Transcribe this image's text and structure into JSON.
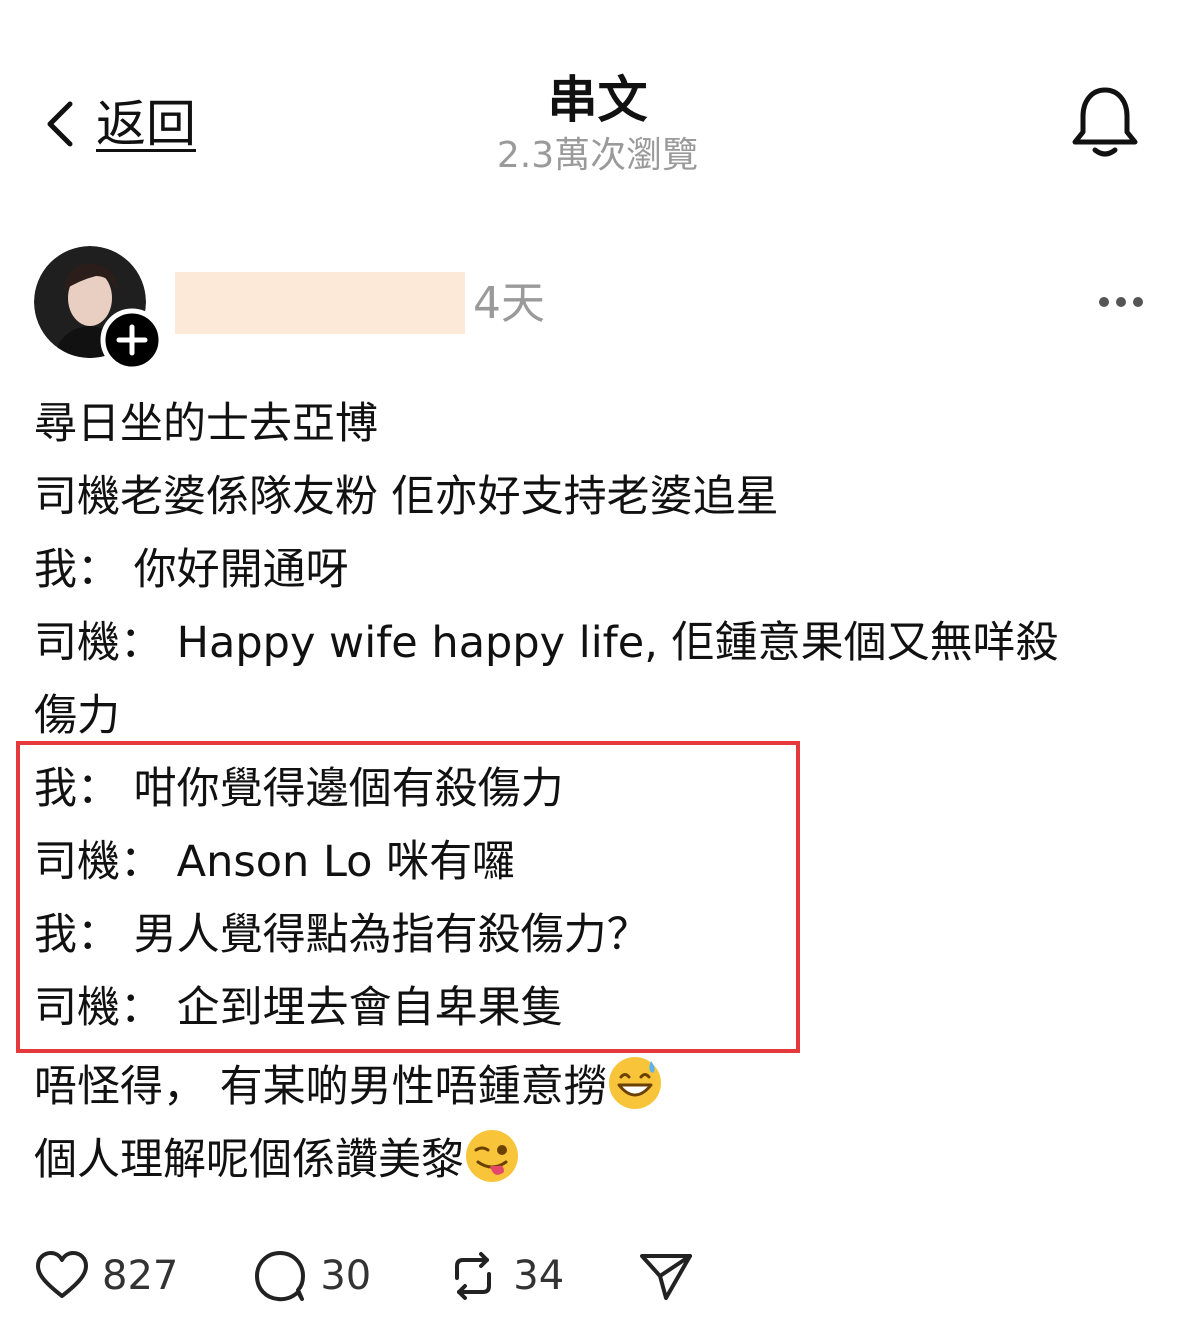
{
  "header": {
    "back_label": "返回",
    "title": "串文",
    "views": "2.3萬次瀏覽"
  },
  "post": {
    "time": "4天",
    "lines_before": [
      "尋日坐的士去亞博",
      "司機老婆係隊友粉 佢亦好支持老婆追星",
      "我： 你好開通呀",
      "司機： Happy wife happy life, 佢鍾意果個又無咩殺",
      "傷力"
    ],
    "highlighted_lines": [
      "我： 咁你覺得邊個有殺傷力",
      "司機： Anson Lo 咪有囉",
      "我： 男人覺得點為指有殺傷力？",
      "司機： 企到埋去會自卑果隻"
    ],
    "lines_after": [
      "唔怪得， 有某啲男性唔鍾意撈",
      "個人理解呢個係讚美黎"
    ],
    "emojis": [
      "grinning-sweat-emoji",
      "winking-tongue-emoji"
    ],
    "highlight_color": "#e5393b"
  },
  "actions": {
    "likes": "827",
    "comments": "30",
    "reposts": "34"
  }
}
